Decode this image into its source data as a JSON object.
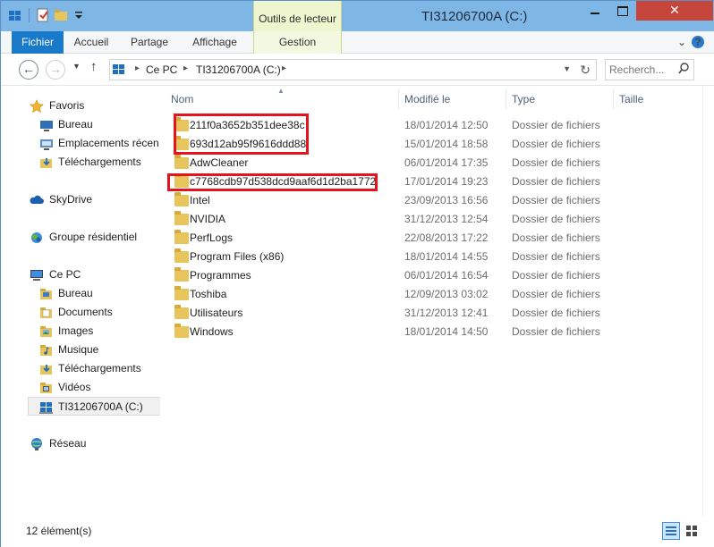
{
  "window": {
    "title": "TI31206700A (C:)",
    "context_tab_group": "Outils de lecteur",
    "close_glyph": "✕"
  },
  "ribbon": {
    "file_tab": "Fichier",
    "tabs": [
      "Accueil",
      "Partage",
      "Affichage"
    ],
    "context_tab": "Gestion",
    "help": "?"
  },
  "address": {
    "crumbs": [
      "Ce PC",
      "TI31206700A (C:)"
    ],
    "search_placeholder": "Recherch..."
  },
  "sidebar": {
    "favorites": {
      "label": "Favoris",
      "icon": "star-icon"
    },
    "favorites_items": [
      {
        "label": "Bureau",
        "icon": "desktop-icon"
      },
      {
        "label": "Emplacements récen",
        "icon": "recent-places-icon"
      },
      {
        "label": "Téléchargements",
        "icon": "downloads-icon"
      }
    ],
    "skydrive": {
      "label": "SkyDrive",
      "icon": "cloud-icon"
    },
    "homegroup": {
      "label": "Groupe résidentiel",
      "icon": "homegroup-icon"
    },
    "this_pc": {
      "label": "Ce PC",
      "icon": "computer-icon"
    },
    "pc_items": [
      {
        "label": "Bureau",
        "icon": "folder-icon"
      },
      {
        "label": "Documents",
        "icon": "documents-icon"
      },
      {
        "label": "Images",
        "icon": "pictures-icon"
      },
      {
        "label": "Musique",
        "icon": "music-icon"
      },
      {
        "label": "Téléchargements",
        "icon": "downloads-icon"
      },
      {
        "label": "Vidéos",
        "icon": "videos-icon"
      },
      {
        "label": "TI31206700A (C:)",
        "icon": "drive-icon"
      }
    ],
    "network": {
      "label": "Réseau",
      "icon": "network-icon"
    }
  },
  "columns": {
    "name": "Nom",
    "modified": "Modifié le",
    "type": "Type",
    "size": "Taille"
  },
  "files": [
    {
      "name": "211f0a3652b351dee38c",
      "modified": "18/01/2014 12:50",
      "type": "Dossier de fichiers"
    },
    {
      "name": "693d12ab95f9616ddd88",
      "modified": "15/01/2014 18:58",
      "type": "Dossier de fichiers"
    },
    {
      "name": "AdwCleaner",
      "modified": "06/01/2014 17:35",
      "type": "Dossier de fichiers"
    },
    {
      "name": "c7768cdb97d538dcd9aaf6d1d2ba1772",
      "modified": "17/01/2014 19:23",
      "type": "Dossier de fichiers"
    },
    {
      "name": "Intel",
      "modified": "23/09/2013 16:56",
      "type": "Dossier de fichiers"
    },
    {
      "name": "NVIDIA",
      "modified": "31/12/2013 12:54",
      "type": "Dossier de fichiers"
    },
    {
      "name": "PerfLogs",
      "modified": "22/08/2013 17:22",
      "type": "Dossier de fichiers"
    },
    {
      "name": "Program Files (x86)",
      "modified": "18/01/2014 14:55",
      "type": "Dossier de fichiers"
    },
    {
      "name": "Programmes",
      "modified": "06/01/2014 16:54",
      "type": "Dossier de fichiers"
    },
    {
      "name": "Toshiba",
      "modified": "12/09/2013 03:02",
      "type": "Dossier de fichiers"
    },
    {
      "name": "Utilisateurs",
      "modified": "31/12/2013 12:41",
      "type": "Dossier de fichiers"
    },
    {
      "name": "Windows",
      "modified": "18/01/2014 14:50",
      "type": "Dossier de fichiers"
    }
  ],
  "status": {
    "count": "12 élément(s)"
  },
  "colors": {
    "highlight": "#e3141d",
    "file_tab": "#1979ca",
    "close": "#c7463b"
  }
}
